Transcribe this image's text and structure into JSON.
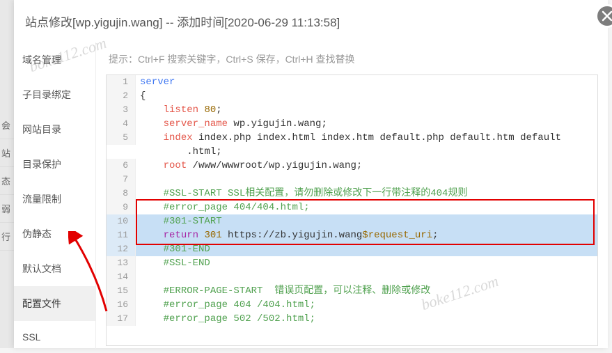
{
  "title": "站点修改[wp.yigujin.wang] -- 添加时间[2020-06-29 11:13:58]",
  "hint": "提示：Ctrl+F 搜索关键字，Ctrl+S 保存，Ctrl+H 查找替换",
  "bg_items": [
    "会",
    "站",
    "态",
    "弱",
    "行"
  ],
  "sidebar": {
    "items": [
      {
        "label": "域名管理"
      },
      {
        "label": "子目录绑定"
      },
      {
        "label": "网站目录"
      },
      {
        "label": "目录保护"
      },
      {
        "label": "流量限制"
      },
      {
        "label": "伪静态"
      },
      {
        "label": "默认文档"
      },
      {
        "label": "配置文件",
        "active": true
      },
      {
        "label": "SSL"
      }
    ]
  },
  "code": {
    "lines": [
      [
        {
          "t": "server",
          "c": "bl"
        }
      ],
      [
        {
          "t": "{",
          "c": ""
        }
      ],
      [
        {
          "t": "    ",
          "c": ""
        },
        {
          "t": "listen",
          "c": "id"
        },
        {
          "t": " ",
          "c": ""
        },
        {
          "t": "80",
          "c": "num"
        },
        {
          "t": ";",
          "c": ""
        }
      ],
      [
        {
          "t": "    ",
          "c": ""
        },
        {
          "t": "server_name",
          "c": "id"
        },
        {
          "t": " wp.yigujin.wang;",
          "c": ""
        }
      ],
      [
        {
          "t": "    ",
          "c": ""
        },
        {
          "t": "index",
          "c": "id"
        },
        {
          "t": " index.php index.html index.htm default.php default.htm default",
          "c": ""
        }
      ],
      [
        {
          "t": "        .html;",
          "c": ""
        }
      ],
      [
        {
          "t": "    ",
          "c": ""
        },
        {
          "t": "root",
          "c": "id"
        },
        {
          "t": " /www/wwwroot/wp.yigujin.wang;",
          "c": ""
        }
      ],
      [
        {
          "t": "    ",
          "c": ""
        }
      ],
      [
        {
          "t": "    ",
          "c": ""
        },
        {
          "t": "#SSL-START SSL相关配置，请勿删除或修改下一行带注释的404规则",
          "c": "cm"
        }
      ],
      [
        {
          "t": "    ",
          "c": ""
        },
        {
          "t": "#error_page 404/404.html;",
          "c": "cm"
        }
      ],
      [
        {
          "t": "    ",
          "c": ""
        },
        {
          "t": "#301-START",
          "c": "cm"
        }
      ],
      [
        {
          "t": "    ",
          "c": ""
        },
        {
          "t": "return",
          "c": "kw"
        },
        {
          "t": " ",
          "c": ""
        },
        {
          "t": "301",
          "c": "num"
        },
        {
          "t": " https://zb.yigujin.wang",
          "c": ""
        },
        {
          "t": "$request_uri",
          "c": "var"
        },
        {
          "t": ";",
          "c": ""
        }
      ],
      [
        {
          "t": "    ",
          "c": ""
        },
        {
          "t": "#301-END",
          "c": "cm"
        }
      ],
      [
        {
          "t": "    ",
          "c": ""
        },
        {
          "t": "#SSL-END",
          "c": "cm"
        }
      ],
      [
        {
          "t": "    ",
          "c": ""
        }
      ],
      [
        {
          "t": "    ",
          "c": ""
        },
        {
          "t": "#ERROR-PAGE-START  错误页配置，可以注释、删除或修改",
          "c": "cm"
        }
      ],
      [
        {
          "t": "    ",
          "c": ""
        },
        {
          "t": "#error_page 404 /404.html;",
          "c": "cm"
        }
      ],
      [
        {
          "t": "    ",
          "c": ""
        },
        {
          "t": "#error_page 502 /502.html;",
          "c": "cm"
        }
      ]
    ],
    "line_numbers": [
      1,
      2,
      3,
      4,
      5,
      "",
      6,
      7,
      8,
      9,
      10,
      11,
      12,
      13,
      14,
      15,
      16,
      17
    ],
    "highlighted_rows": [
      10,
      11,
      12
    ]
  },
  "watermark": "boke112.com"
}
